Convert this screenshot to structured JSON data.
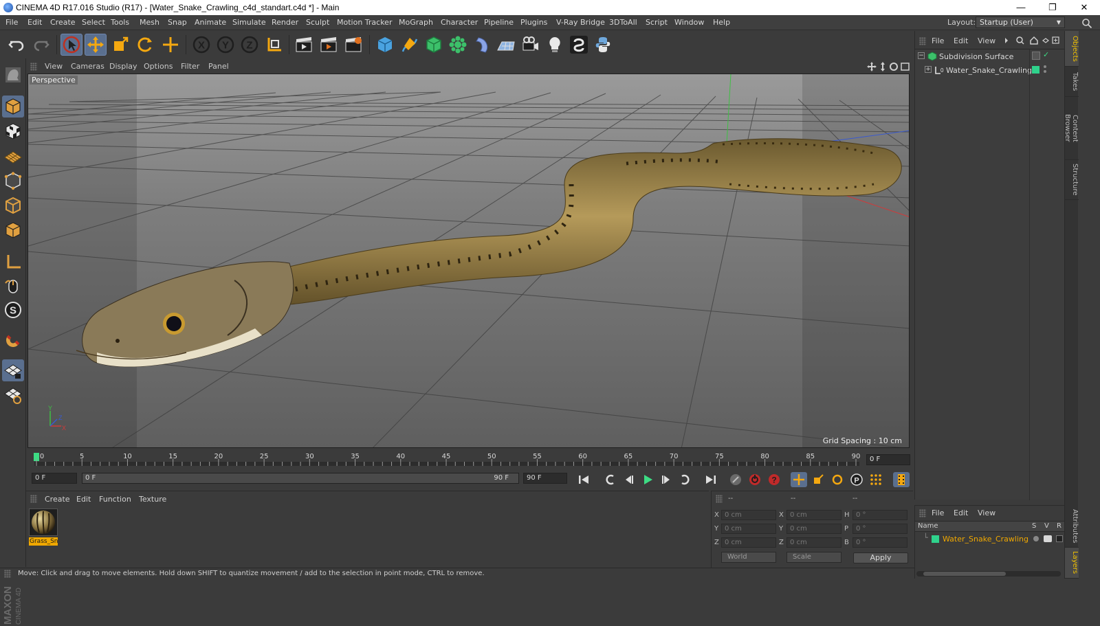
{
  "window": {
    "title": "CINEMA 4D R17.016 Studio (R17) - [Water_Snake_Crawling_c4d_standart.c4d *] - Main",
    "minimize": "—",
    "restore": "❐",
    "close": "✕"
  },
  "menu": [
    "File",
    "Edit",
    "Create",
    "Select",
    "Tools",
    "Mesh",
    "Snap",
    "Animate",
    "Simulate",
    "Render",
    "Sculpt",
    "Motion Tracker",
    "MoGraph",
    "Character",
    "Pipeline",
    "Plugins",
    "V-Ray Bridge",
    "3DToAll",
    "Script",
    "Window",
    "Help"
  ],
  "layout": {
    "label": "Layout:",
    "value": "Startup (User)"
  },
  "viewport": {
    "menu": [
      "View",
      "Cameras",
      "Display",
      "Options",
      "Filter",
      "Panel"
    ],
    "camera_label": "Perspective",
    "grid_spacing": "Grid Spacing : 10 cm",
    "axis_labels": {
      "y": "Y",
      "z": "Z",
      "x": "X"
    }
  },
  "timeline": {
    "ticks": [
      "0",
      "5",
      "10",
      "15",
      "20",
      "25",
      "30",
      "35",
      "40",
      "45",
      "50",
      "55",
      "60",
      "65",
      "70",
      "75",
      "80",
      "85",
      "90"
    ],
    "current_frame": "0 F",
    "start_field": "0 F",
    "slider_start": "0 F",
    "slider_end": "90 F",
    "end_field": "90 F"
  },
  "material_manager": {
    "menu": [
      "Create",
      "Edit",
      "Function",
      "Texture"
    ],
    "materials": [
      {
        "name": "Grass_Sn"
      }
    ]
  },
  "coordinates": {
    "headers": [
      "--",
      "--",
      "--"
    ],
    "rows": [
      {
        "pos_label": "X",
        "pos": "0 cm",
        "size_label": "X",
        "size": "0 cm",
        "rot_label": "H",
        "rot": "0 °"
      },
      {
        "pos_label": "Y",
        "pos": "0 cm",
        "size_label": "Y",
        "size": "0 cm",
        "rot_label": "P",
        "rot": "0 °"
      },
      {
        "pos_label": "Z",
        "pos": "0 cm",
        "size_label": "Z",
        "size": "0 cm",
        "rot_label": "B",
        "rot": "0 °"
      }
    ],
    "mode": "World",
    "type": "Scale",
    "apply": "Apply"
  },
  "status": "Move: Click and drag to move elements. Hold down SHIFT to quantize movement / add to the selection in point mode, CTRL to remove.",
  "object_manager": {
    "menu": [
      "File",
      "Edit",
      "View"
    ],
    "objects": [
      {
        "name": "Subdivision Surface",
        "icon": "subdivision-icon"
      },
      {
        "name": "Water_Snake_Crawling",
        "icon": "null-object-icon",
        "color": "#2fd28c"
      }
    ]
  },
  "layer_manager": {
    "menu": [
      "File",
      "Edit",
      "View"
    ],
    "columns": {
      "name": "Name",
      "s": "S",
      "v": "V",
      "r": "R"
    },
    "layers": [
      {
        "name": "Water_Snake_Crawling",
        "color": "#2fd28c"
      }
    ]
  },
  "side_tabs": [
    "Objects",
    "Takes",
    "Content Browser",
    "Structure"
  ],
  "side_tabs_bottom": [
    "Attributes",
    "Layers"
  ],
  "brand": {
    "line1": "MAXON",
    "line2": "CINEMA 4D"
  },
  "colors": {
    "accent_active": "#5a6f8f",
    "material_selected": "#f0a800",
    "layer_green": "#2fd28c",
    "keyframe_green": "#3ddc84"
  }
}
